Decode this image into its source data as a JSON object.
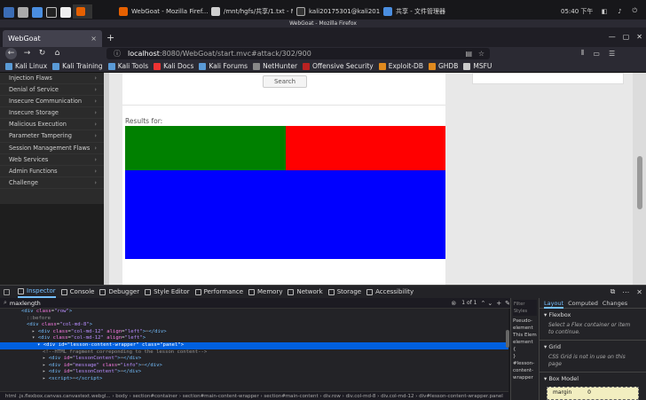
{
  "system": {
    "tasks": [
      "WebGoat - Mozilla Firef...",
      "/mnt/hgfs/共享/1.txt - M...",
      "kali20175301@kali2017...",
      "共享 - 文件管理器"
    ],
    "clock": "05:40 下午"
  },
  "window": {
    "title": "WebGoat - Mozilla Firefox"
  },
  "browser": {
    "tab": {
      "title": "WebGoat",
      "close": "×"
    },
    "new_tab": "+",
    "url": {
      "host": "localhost",
      "path": ":8080/WebGoat/start.mvc#attack/302/900"
    },
    "bookmarks": [
      "Kali Linux",
      "Kali Training",
      "Kali Tools",
      "Kali Docs",
      "Kali Forums",
      "NetHunter",
      "Offensive Security",
      "Exploit-DB",
      "GHDB",
      "MSFU"
    ]
  },
  "webgoat": {
    "menu": [
      "Injection Flaws",
      "Denial of Service",
      "Insecure Communication",
      "Insecure Storage",
      "Malicious Execution",
      "Parameter Tampering",
      "Session Management Flaws",
      "Web Services",
      "Admin Functions",
      "Challenge"
    ],
    "search_button": "Search",
    "results_label": "Results for:",
    "colors": {
      "green": "#008000",
      "red": "#ff0000",
      "blue": "#0000ff"
    }
  },
  "devtools": {
    "tabs": [
      "Inspector",
      "Console",
      "Debugger",
      "Style Editor",
      "Performance",
      "Memory",
      "Network",
      "Storage",
      "Accessibility"
    ],
    "search_value": "maxlength",
    "search_count": "1 of 1",
    "filter_placeholder": "Filter Styles",
    "markup_lines": [
      {
        "indent": 4,
        "html": "<span class='tg'>&lt;div</span> <span class='at'>class</span>=<span class='av'>\"row\"</span><span class='tg'>&gt;</span>"
      },
      {
        "indent": 5,
        "html": "<span class='cm'>::before</span>"
      },
      {
        "indent": 5,
        "html": "<span class='tg'>&lt;div</span> <span class='at'>class</span>=<span class='av'>\"col-md-8\"</span><span class='tg'>&gt;</span>"
      },
      {
        "indent": 6,
        "html": "▸ <span class='tg'>&lt;div</span> <span class='at'>class</span>=<span class='av'>\"col-md-12\"</span> <span class='at'>align</span>=<span class='av'>\"left\"</span><span class='tg'>&gt;</span>⋯<span class='tg'>&lt;/div&gt;</span>"
      },
      {
        "indent": 6,
        "html": "▾ <span class='tg'>&lt;div</span> <span class='at'>class</span>=<span class='av'>\"col-md-12\"</span> <span class='at'>align</span>=<span class='av'>\"left\"</span><span class='tg'>&gt;</span>"
      },
      {
        "indent": 7,
        "sel": true,
        "html": "▾ <span class='tg'>&lt;div</span> <span class='at'>id</span>=<span class='av'>\"lesson-content-wrapper\"</span> <span class='at'>class</span>=<span class='av'>\"panel\"</span><span class='tg'>&gt;</span>"
      },
      {
        "indent": 8,
        "html": "<span class='cm'>&lt;!--HTML fragment correponding to the lesson content--&gt;</span>"
      },
      {
        "indent": 8,
        "html": "▸ <span class='tg'>&lt;div</span> <span class='at'>id</span>=<span class='av'>\"lessonContent\"</span><span class='tg'>&gt;</span>⋯<span class='tg'>&lt;/div&gt;</span>"
      },
      {
        "indent": 8,
        "html": "▸ <span class='tg'>&lt;div</span> <span class='at'>id</span>=<span class='av'>\"message\"</span> <span class='at'>class</span>=<span class='av'>\"info\"</span><span class='tg'>&gt;</span>⋯<span class='tg'>&lt;/div&gt;</span>"
      },
      {
        "indent": 8,
        "html": "▸ <span class='tg'>&lt;div</span> <span class='at'>id</span>=<span class='av'>\"lessonContent\"</span><span class='tg'>&gt;</span>⋯<span class='tg'>&lt;/div&gt;</span>"
      },
      {
        "indent": 8,
        "html": "▸ <span class='tg'>&lt;script&gt;</span>⋯<span class='tg'>&lt;/script&gt;</span>"
      }
    ],
    "breadcrumbs": "html  .js.flexbox.canvas.canvastext.webgl...  ›  body  ›  section#container  ›  section#main-content-wrapper  ›  section#main-content  ›  div.row  ›  div.col-md-8  ›  div.col-md-12  ›  div#lesson-content-wrapper.panel",
    "rules": [
      "Pseudo-",
      "element",
      "This Elem",
      "element {",
      "}",
      "#lesson-",
      "content-",
      "wrapper"
    ],
    "layout_tabs": [
      "Layout",
      "Computed",
      "Changes"
    ],
    "flexbox": {
      "title": "Flexbox",
      "note": "Select a Flex container or item to continue."
    },
    "grid": {
      "title": "Grid",
      "note": "CSS Grid is not in use on this page"
    },
    "boxmodel": {
      "title": "Box Model",
      "margin_label": "margin",
      "margin_value": "0"
    }
  }
}
